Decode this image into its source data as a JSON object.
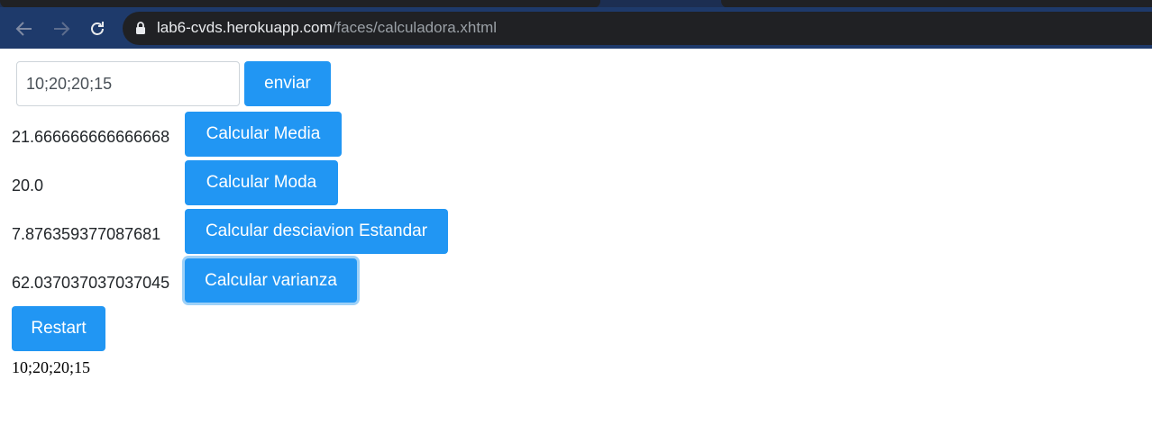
{
  "browser": {
    "url_host": "lab6-cvds.herokuapp.com",
    "url_path": "/faces/calculadora.xhtml",
    "icons": [
      "back-icon",
      "forward-icon",
      "reload-icon",
      "lock-icon"
    ]
  },
  "form": {
    "input_value": "10;20;20;15",
    "submit_label": "enviar"
  },
  "results": [
    {
      "value": "21.666666666666668",
      "button": "Calcular Media"
    },
    {
      "value": "20.0",
      "button": "Calcular Moda"
    },
    {
      "value": "7.876359377087681",
      "button": "Calcular desciavion Estandar"
    },
    {
      "value": "62.037037037037045",
      "button": "Calcular varianza"
    }
  ],
  "restart_label": "Restart",
  "data_echo": "10;20;20;15",
  "colors": {
    "button": "#2196f3",
    "chrome_toolbar": "#1e3a6b",
    "omnibox": "#202124"
  }
}
